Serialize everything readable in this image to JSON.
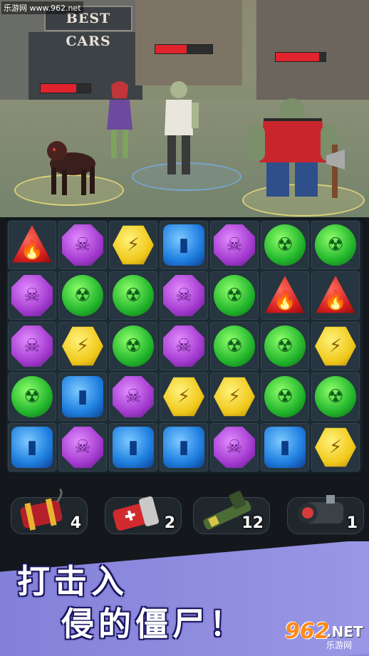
{
  "watermark": "乐游网 www.962.net",
  "scene": {
    "sign": "BEST CARS",
    "health_bars": [
      {
        "name": "dog",
        "fill": 0.72
      },
      {
        "name": "center-zombies",
        "fill": 0.55
      },
      {
        "name": "brute",
        "fill": 0.87
      }
    ]
  },
  "board": {
    "columns": 7,
    "rows": [
      [
        "red",
        "purple",
        "yellow",
        "blue",
        "purple",
        "green",
        "green"
      ],
      [
        "purple",
        "green",
        "green",
        "purple",
        "green",
        "red",
        "red"
      ],
      [
        "purple",
        "yellow",
        "green",
        "purple",
        "green",
        "green",
        "yellow"
      ],
      [
        "green",
        "blue",
        "purple",
        "yellow",
        "yellow",
        "green",
        "green"
      ],
      [
        "blue",
        "purple",
        "blue",
        "blue",
        "purple",
        "blue",
        "yellow"
      ]
    ],
    "gem_icons": {
      "red": "fire-icon",
      "purple": "skull-icon",
      "yellow": "lightning-icon",
      "blue": "bullet-icon",
      "green": "radiation-icon"
    },
    "gem_glyphs": {
      "red": "🔥",
      "purple": "☠",
      "yellow": "⚡",
      "blue": "▮",
      "green": "☢"
    }
  },
  "items": [
    {
      "icon": "dynamite-icon",
      "count": "4"
    },
    {
      "icon": "medkit-icon",
      "count": "2"
    },
    {
      "icon": "grenade-launcher-icon",
      "count": "12"
    },
    {
      "icon": "turret-icon",
      "count": "1"
    }
  ],
  "banner": {
    "line1": "打击入",
    "line2": "侵的僵尸！",
    "logo_number": "962",
    "logo_suffix": ".NET",
    "logo_cn": "乐游网"
  },
  "colors": {
    "red_gem": "#d01c1c",
    "purple_gem": "#a43bd0",
    "yellow_gem": "#f0c81a",
    "blue_gem": "#1f7fe0",
    "green_gem": "#22b52c",
    "health": "#e0232d",
    "banner": "#8b88dc"
  }
}
